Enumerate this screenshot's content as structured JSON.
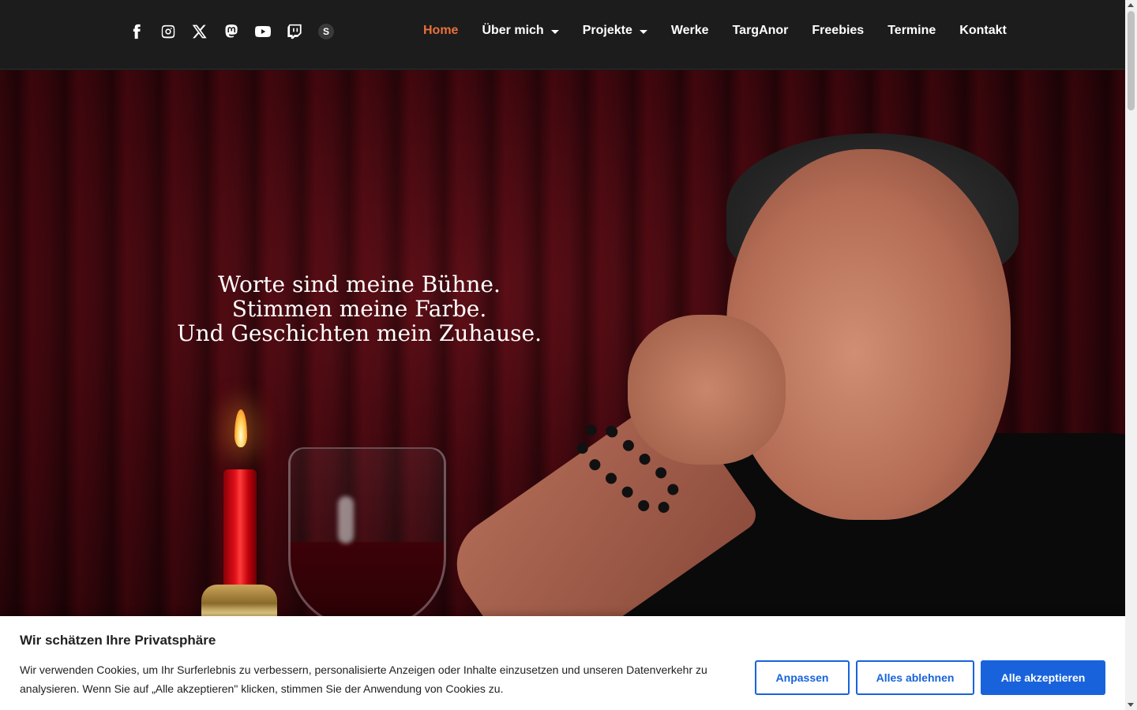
{
  "header": {
    "social_icons": [
      {
        "name": "facebook-icon"
      },
      {
        "name": "instagram-icon"
      },
      {
        "name": "x-twitter-icon"
      },
      {
        "name": "mastodon-icon"
      },
      {
        "name": "youtube-icon"
      },
      {
        "name": "twitch-icon"
      },
      {
        "name": "s-icon",
        "label": "S"
      }
    ],
    "nav": {
      "home": "Home",
      "about": "Über mich",
      "projects": "Projekte",
      "works": "Werke",
      "targanor": "TargAnor",
      "freebies": "Freebies",
      "events": "Termine",
      "contact": "Kontakt"
    }
  },
  "hero": {
    "line1": "Worte sind meine Bühne.",
    "line2": "Stimmen meine Farbe.",
    "line3": "Und Geschichten mein Zuhause."
  },
  "cookie": {
    "title": "Wir schätzen Ihre Privatsphäre",
    "text": "Wir verwenden Cookies, um Ihr Surferlebnis zu verbessern, personalisierte Anzeigen oder Inhalte einzusetzen und unseren Datenverkehr zu analysieren. Wenn Sie auf „Alle akzeptieren\" klicken, stimmen Sie der Anwendung von Cookies zu.",
    "btn_customize": "Anpassen",
    "btn_reject": "Alles ablehnen",
    "btn_accept": "Alle akzeptieren"
  },
  "colors": {
    "header_bg": "#1c1c1c",
    "nav_active": "#e8713a",
    "primary_button": "#1863dc"
  }
}
